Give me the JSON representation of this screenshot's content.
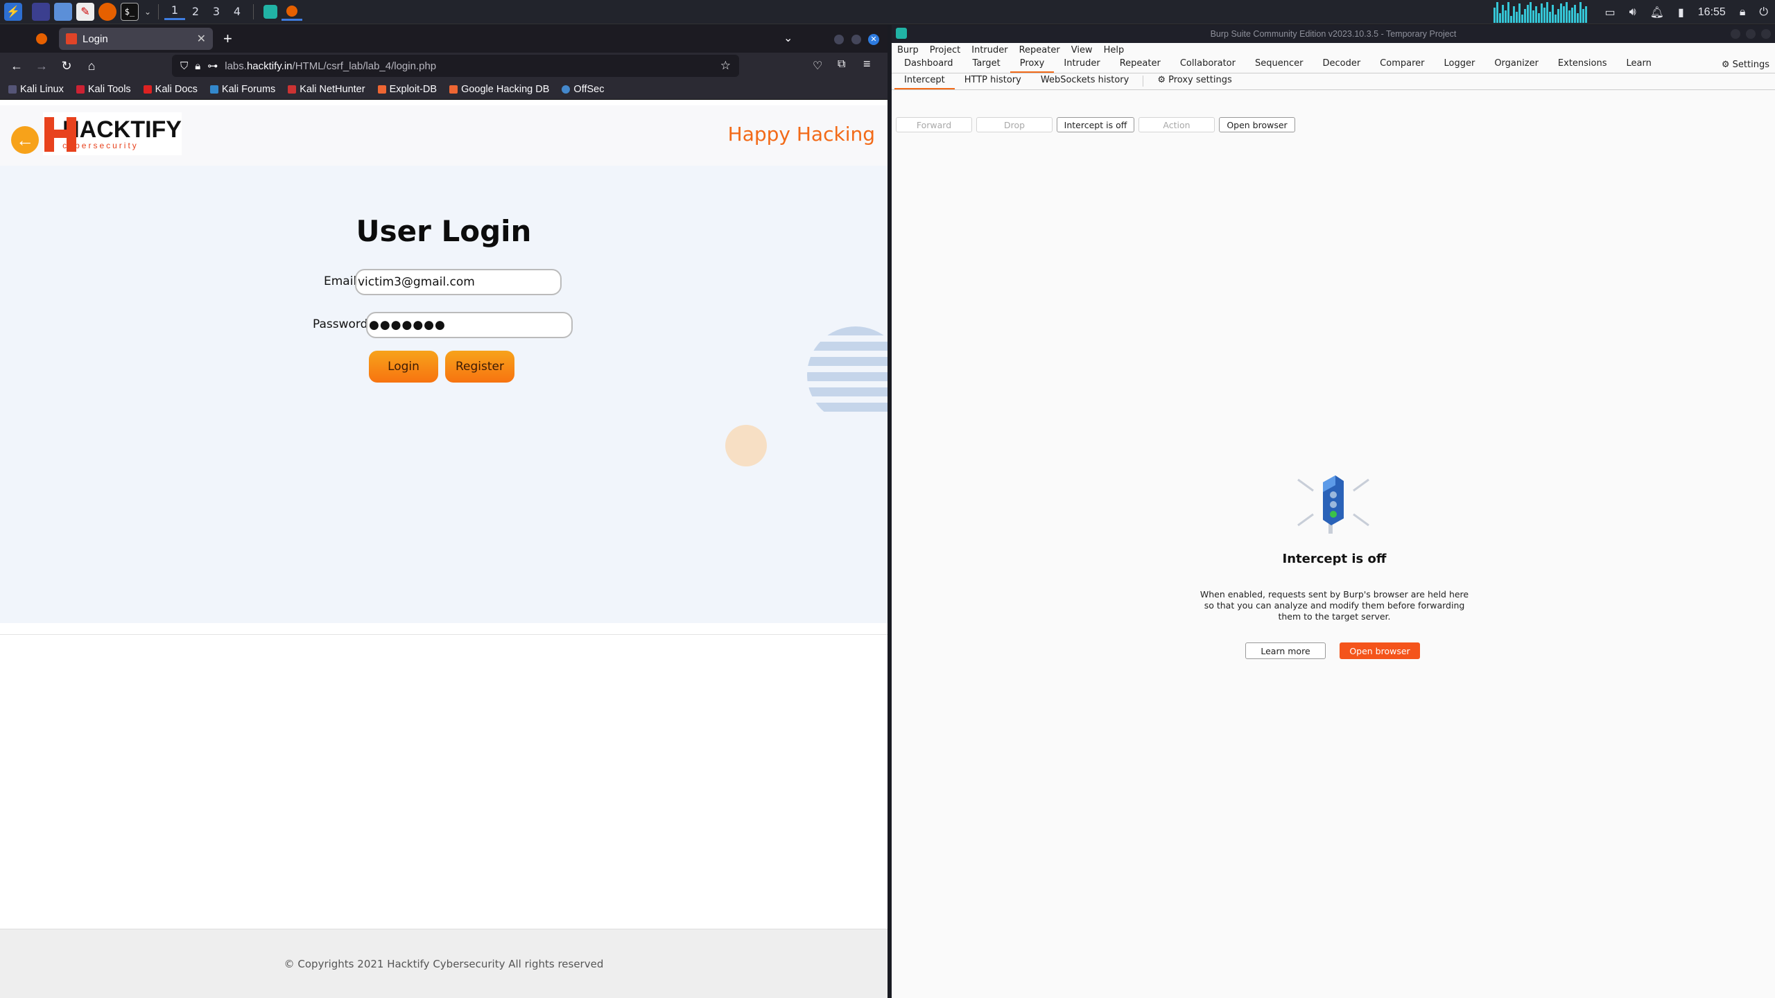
{
  "taskbar": {
    "workspaces": [
      "1",
      "2",
      "3",
      "4"
    ],
    "active_workspace": "1",
    "clock": "16:55",
    "cpu_graph_color": "#35c6d6"
  },
  "firefox": {
    "tab": {
      "title": "Login",
      "close_icon": "close-icon"
    },
    "url": {
      "prefix": "labs.",
      "host": "hacktify.in",
      "path": "/HTML/csrf_lab/lab_4/login.php"
    },
    "bookmarks": [
      "Kali Linux",
      "Kali Tools",
      "Kali Docs",
      "Kali Forums",
      "Kali NetHunter",
      "Exploit-DB",
      "Google Hacking DB",
      "OffSec"
    ],
    "page": {
      "logo_text": "HACKTIFY",
      "logo_subtext": "cybersecurity",
      "tagline": "Happy Hacking",
      "title": "User Login",
      "email_label": "Email",
      "email_value": "victim3@gmail.com",
      "password_label": "Password",
      "password_value": "●●●●●●●",
      "login_button": "Login",
      "register_button": "Register",
      "footer": "© Copyrights 2021 Hacktify Cybersecurity All rights reserved",
      "accent": "#f26a18"
    }
  },
  "burp": {
    "window_title": "Burp Suite Community Edition v2023.10.3.5 - Temporary Project",
    "menu": [
      "Burp",
      "Project",
      "Intruder",
      "Repeater",
      "View",
      "Help"
    ],
    "tabs": [
      "Dashboard",
      "Target",
      "Proxy",
      "Intruder",
      "Repeater",
      "Collaborator",
      "Sequencer",
      "Decoder",
      "Comparer",
      "Logger",
      "Organizer",
      "Extensions",
      "Learn"
    ],
    "active_tab": "Proxy",
    "settings_label": "Settings",
    "subtabs": [
      "Intercept",
      "HTTP history",
      "WebSockets history"
    ],
    "proxy_settings_label": "Proxy settings",
    "toolbar": {
      "forward": "Forward",
      "drop": "Drop",
      "intercept": "Intercept is off",
      "action": "Action",
      "open_browser": "Open browser"
    },
    "intercept_panel": {
      "title": "Intercept is off",
      "desc_line1": "When enabled, requests sent by Burp's browser are held here",
      "desc_line2": "so that you can analyze and modify them before forwarding",
      "desc_line3": "them to the target server.",
      "learn_more": "Learn more",
      "open_browser": "Open browser"
    },
    "accent": "#f26a18"
  }
}
